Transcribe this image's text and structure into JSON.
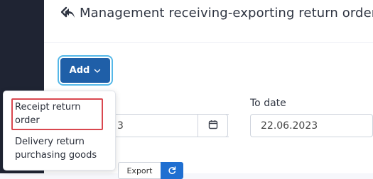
{
  "header": {
    "title": "Management receiving-exporting return order",
    "icon": "reply-all-icon"
  },
  "toolbar": {
    "add_label": "Add",
    "export_label": "Export",
    "refresh_icon": "refresh-icon"
  },
  "filters": {
    "from_date_value": "3",
    "to_date_label": "To date",
    "to_date_value": "22.06.2023"
  },
  "dropdown": {
    "items": [
      {
        "label": "Receipt return order"
      },
      {
        "label": "Delivery return purchasing goods"
      }
    ]
  },
  "colors": {
    "sidebar": "#1f2433",
    "primary": "#1f5fa8",
    "highlight": "#d9474f",
    "focus_ring": "#55b8e8"
  }
}
